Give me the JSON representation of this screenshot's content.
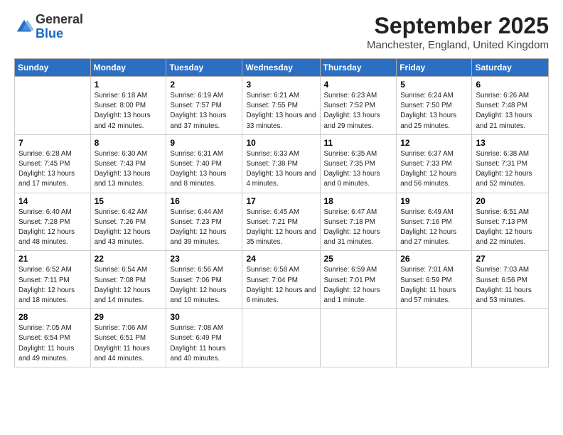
{
  "header": {
    "logo": {
      "line1": "General",
      "line2": "Blue"
    },
    "title": "September 2025",
    "location": "Manchester, England, United Kingdom"
  },
  "calendar": {
    "weekdays": [
      "Sunday",
      "Monday",
      "Tuesday",
      "Wednesday",
      "Thursday",
      "Friday",
      "Saturday"
    ],
    "weeks": [
      [
        {
          "day": "",
          "sunrise": "",
          "sunset": "",
          "daylight": ""
        },
        {
          "day": "1",
          "sunrise": "Sunrise: 6:18 AM",
          "sunset": "Sunset: 8:00 PM",
          "daylight": "Daylight: 13 hours and 42 minutes."
        },
        {
          "day": "2",
          "sunrise": "Sunrise: 6:19 AM",
          "sunset": "Sunset: 7:57 PM",
          "daylight": "Daylight: 13 hours and 37 minutes."
        },
        {
          "day": "3",
          "sunrise": "Sunrise: 6:21 AM",
          "sunset": "Sunset: 7:55 PM",
          "daylight": "Daylight: 13 hours and 33 minutes."
        },
        {
          "day": "4",
          "sunrise": "Sunrise: 6:23 AM",
          "sunset": "Sunset: 7:52 PM",
          "daylight": "Daylight: 13 hours and 29 minutes."
        },
        {
          "day": "5",
          "sunrise": "Sunrise: 6:24 AM",
          "sunset": "Sunset: 7:50 PM",
          "daylight": "Daylight: 13 hours and 25 minutes."
        },
        {
          "day": "6",
          "sunrise": "Sunrise: 6:26 AM",
          "sunset": "Sunset: 7:48 PM",
          "daylight": "Daylight: 13 hours and 21 minutes."
        }
      ],
      [
        {
          "day": "7",
          "sunrise": "Sunrise: 6:28 AM",
          "sunset": "Sunset: 7:45 PM",
          "daylight": "Daylight: 13 hours and 17 minutes."
        },
        {
          "day": "8",
          "sunrise": "Sunrise: 6:30 AM",
          "sunset": "Sunset: 7:43 PM",
          "daylight": "Daylight: 13 hours and 13 minutes."
        },
        {
          "day": "9",
          "sunrise": "Sunrise: 6:31 AM",
          "sunset": "Sunset: 7:40 PM",
          "daylight": "Daylight: 13 hours and 8 minutes."
        },
        {
          "day": "10",
          "sunrise": "Sunrise: 6:33 AM",
          "sunset": "Sunset: 7:38 PM",
          "daylight": "Daylight: 13 hours and 4 minutes."
        },
        {
          "day": "11",
          "sunrise": "Sunrise: 6:35 AM",
          "sunset": "Sunset: 7:35 PM",
          "daylight": "Daylight: 13 hours and 0 minutes."
        },
        {
          "day": "12",
          "sunrise": "Sunrise: 6:37 AM",
          "sunset": "Sunset: 7:33 PM",
          "daylight": "Daylight: 12 hours and 56 minutes."
        },
        {
          "day": "13",
          "sunrise": "Sunrise: 6:38 AM",
          "sunset": "Sunset: 7:31 PM",
          "daylight": "Daylight: 12 hours and 52 minutes."
        }
      ],
      [
        {
          "day": "14",
          "sunrise": "Sunrise: 6:40 AM",
          "sunset": "Sunset: 7:28 PM",
          "daylight": "Daylight: 12 hours and 48 minutes."
        },
        {
          "day": "15",
          "sunrise": "Sunrise: 6:42 AM",
          "sunset": "Sunset: 7:26 PM",
          "daylight": "Daylight: 12 hours and 43 minutes."
        },
        {
          "day": "16",
          "sunrise": "Sunrise: 6:44 AM",
          "sunset": "Sunset: 7:23 PM",
          "daylight": "Daylight: 12 hours and 39 minutes."
        },
        {
          "day": "17",
          "sunrise": "Sunrise: 6:45 AM",
          "sunset": "Sunset: 7:21 PM",
          "daylight": "Daylight: 12 hours and 35 minutes."
        },
        {
          "day": "18",
          "sunrise": "Sunrise: 6:47 AM",
          "sunset": "Sunset: 7:18 PM",
          "daylight": "Daylight: 12 hours and 31 minutes."
        },
        {
          "day": "19",
          "sunrise": "Sunrise: 6:49 AM",
          "sunset": "Sunset: 7:16 PM",
          "daylight": "Daylight: 12 hours and 27 minutes."
        },
        {
          "day": "20",
          "sunrise": "Sunrise: 6:51 AM",
          "sunset": "Sunset: 7:13 PM",
          "daylight": "Daylight: 12 hours and 22 minutes."
        }
      ],
      [
        {
          "day": "21",
          "sunrise": "Sunrise: 6:52 AM",
          "sunset": "Sunset: 7:11 PM",
          "daylight": "Daylight: 12 hours and 18 minutes."
        },
        {
          "day": "22",
          "sunrise": "Sunrise: 6:54 AM",
          "sunset": "Sunset: 7:08 PM",
          "daylight": "Daylight: 12 hours and 14 minutes."
        },
        {
          "day": "23",
          "sunrise": "Sunrise: 6:56 AM",
          "sunset": "Sunset: 7:06 PM",
          "daylight": "Daylight: 12 hours and 10 minutes."
        },
        {
          "day": "24",
          "sunrise": "Sunrise: 6:58 AM",
          "sunset": "Sunset: 7:04 PM",
          "daylight": "Daylight: 12 hours and 6 minutes."
        },
        {
          "day": "25",
          "sunrise": "Sunrise: 6:59 AM",
          "sunset": "Sunset: 7:01 PM",
          "daylight": "Daylight: 12 hours and 1 minute."
        },
        {
          "day": "26",
          "sunrise": "Sunrise: 7:01 AM",
          "sunset": "Sunset: 6:59 PM",
          "daylight": "Daylight: 11 hours and 57 minutes."
        },
        {
          "day": "27",
          "sunrise": "Sunrise: 7:03 AM",
          "sunset": "Sunset: 6:56 PM",
          "daylight": "Daylight: 11 hours and 53 minutes."
        }
      ],
      [
        {
          "day": "28",
          "sunrise": "Sunrise: 7:05 AM",
          "sunset": "Sunset: 6:54 PM",
          "daylight": "Daylight: 11 hours and 49 minutes."
        },
        {
          "day": "29",
          "sunrise": "Sunrise: 7:06 AM",
          "sunset": "Sunset: 6:51 PM",
          "daylight": "Daylight: 11 hours and 44 minutes."
        },
        {
          "day": "30",
          "sunrise": "Sunrise: 7:08 AM",
          "sunset": "Sunset: 6:49 PM",
          "daylight": "Daylight: 11 hours and 40 minutes."
        },
        {
          "day": "",
          "sunrise": "",
          "sunset": "",
          "daylight": ""
        },
        {
          "day": "",
          "sunrise": "",
          "sunset": "",
          "daylight": ""
        },
        {
          "day": "",
          "sunrise": "",
          "sunset": "",
          "daylight": ""
        },
        {
          "day": "",
          "sunrise": "",
          "sunset": "",
          "daylight": ""
        }
      ]
    ]
  }
}
